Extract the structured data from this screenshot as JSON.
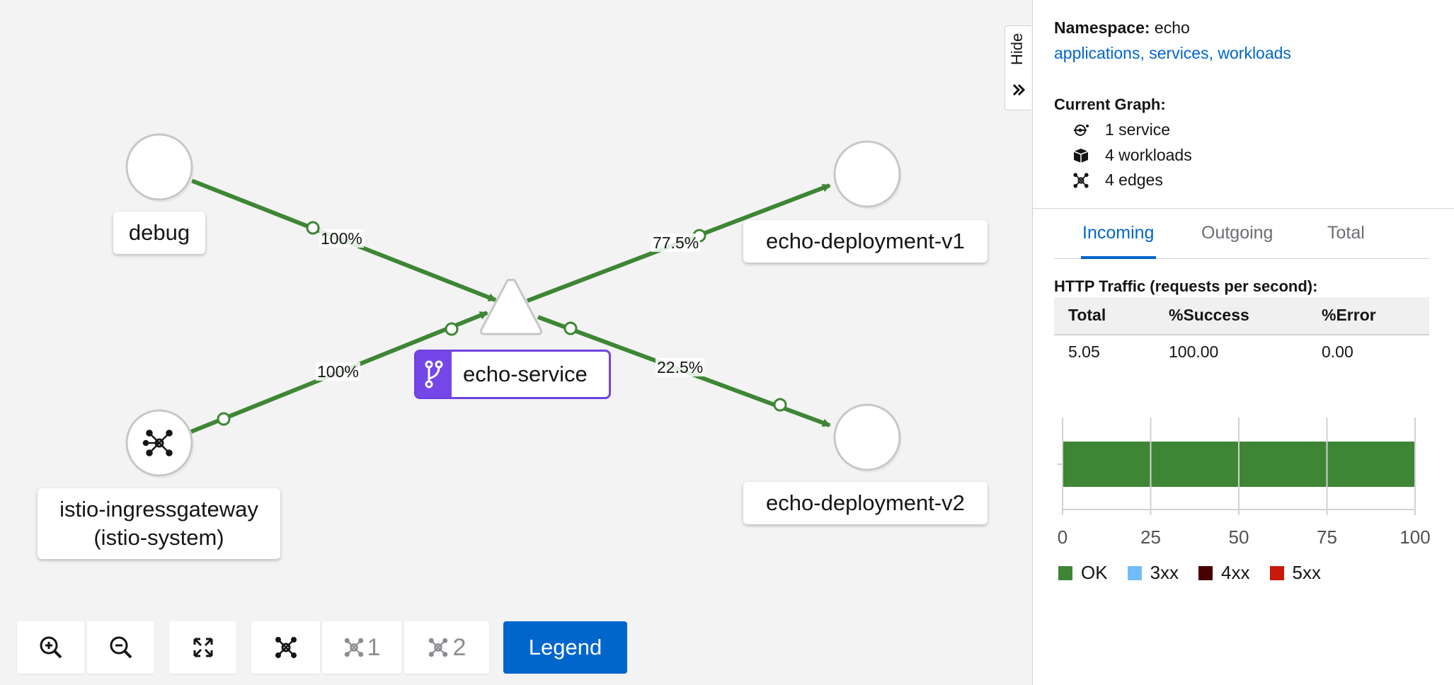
{
  "graph": {
    "nodes": {
      "debug": "debug",
      "gateway_line1": "istio-ingressgateway",
      "gateway_line2": "(istio-system)",
      "service": "echo-service",
      "v1": "echo-deployment-v1",
      "v2": "echo-deployment-v2"
    },
    "edges": {
      "debug_to_service": "100%",
      "gateway_to_service": "100%",
      "service_to_v1": "77.5%",
      "service_to_v2": "22.5%"
    },
    "edge_color": "#3e8635",
    "service_badge_color": "#7546e8"
  },
  "toolbar": {
    "zoom_in_icon": "zoom-in-icon",
    "zoom_out_icon": "zoom-out-icon",
    "fit_icon": "fit-to-screen-icon",
    "layout_default_icon": "layout-icon",
    "layout1_label": "1",
    "layout2_label": "2",
    "legend_label": "Legend"
  },
  "hide_tab": {
    "label": "Hide"
  },
  "panel": {
    "namespace_label": "Namespace:",
    "namespace_value": "echo",
    "namespace_links": "applications, services, workloads",
    "current_graph_title": "Current Graph:",
    "current_graph_items": [
      {
        "icon": "service-icon",
        "text": "1 service"
      },
      {
        "icon": "workload-icon",
        "text": "4 workloads"
      },
      {
        "icon": "edges-icon",
        "text": "4 edges"
      }
    ],
    "tabs": [
      "Incoming",
      "Outgoing",
      "Total"
    ],
    "active_tab": "Incoming",
    "http_title": "HTTP Traffic (requests per second):",
    "table": {
      "headers": [
        "Total",
        "%Success",
        "%Error"
      ],
      "row": [
        "5.05",
        "100.00",
        "0.00"
      ]
    }
  },
  "chart_data": {
    "type": "bar",
    "orientation": "horizontal",
    "stacked": true,
    "xlim": [
      0,
      100
    ],
    "x_ticks": [
      "0",
      "25",
      "50",
      "75",
      "100"
    ],
    "grid": true,
    "legend_placement": "bottom",
    "series": [
      {
        "name": "OK",
        "values": [
          100
        ],
        "color": "#3e8635"
      },
      {
        "name": "3xx",
        "values": [
          0
        ],
        "color": "#73bcf7"
      },
      {
        "name": "4xx",
        "values": [
          0
        ],
        "color": "#470000"
      },
      {
        "name": "5xx",
        "values": [
          0
        ],
        "color": "#c9190b"
      }
    ]
  }
}
